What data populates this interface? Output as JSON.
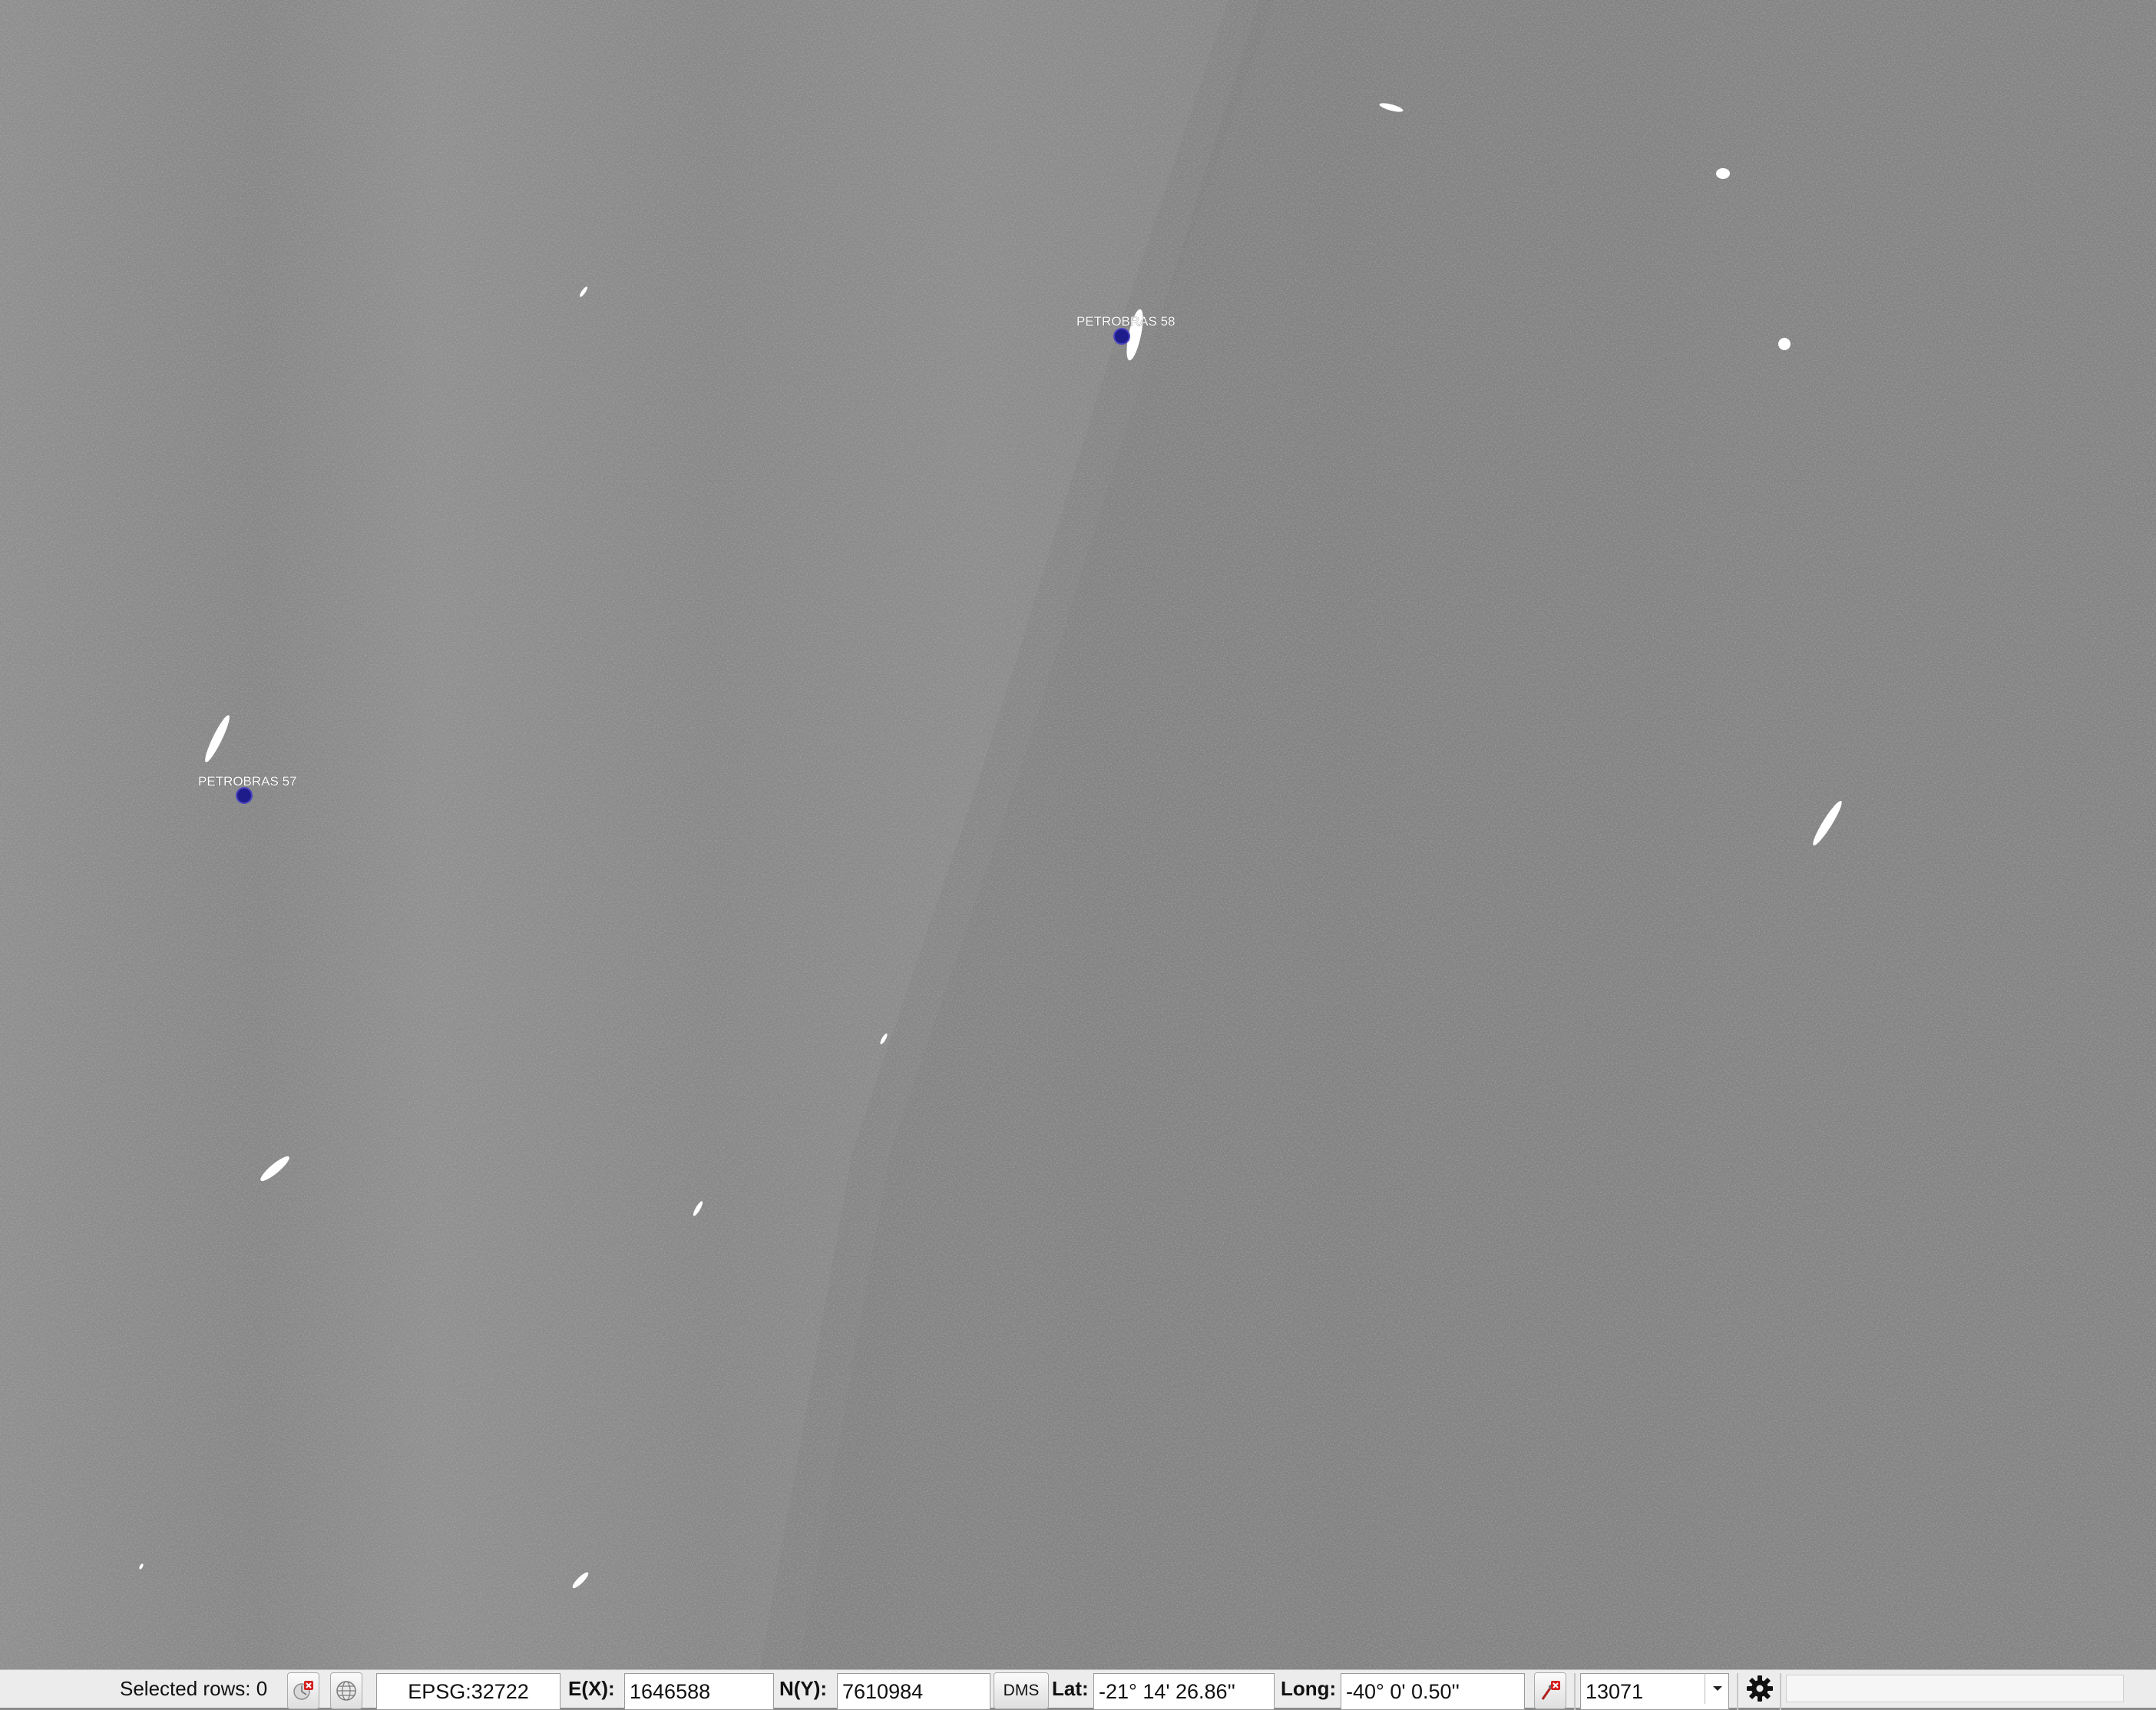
{
  "map": {
    "vessels": [
      {
        "label": "PETROBRAS 58"
      },
      {
        "label": "PETROBRAS 57"
      }
    ],
    "colors": {
      "water": "#8a8a8a",
      "water_dark": "#7a7a7a",
      "ship": "#ffffff",
      "marker": "#1e1b8a"
    }
  },
  "statusbar": {
    "selected_rows": "Selected rows: 0",
    "crs": "EPSG:32722",
    "ex_label": "E(X):",
    "ex_value": "1646588",
    "ny_label": "N(Y):",
    "ny_value": "7610984",
    "dms_button": "DMS",
    "lat_label": "Lat:",
    "lat_value": "-21° 14' 26.86''",
    "long_label": "Long:",
    "long_value": "-40° 0' 0.50''",
    "scale_value": "13071"
  }
}
